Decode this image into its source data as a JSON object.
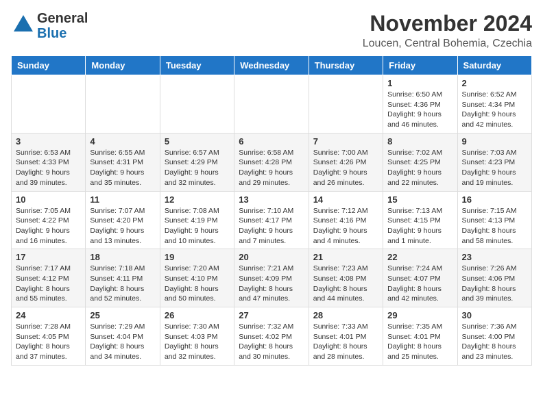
{
  "header": {
    "logo_general": "General",
    "logo_blue": "Blue",
    "month": "November 2024",
    "location": "Loucen, Central Bohemia, Czechia"
  },
  "weekdays": [
    "Sunday",
    "Monday",
    "Tuesday",
    "Wednesday",
    "Thursday",
    "Friday",
    "Saturday"
  ],
  "weeks": [
    [
      {
        "day": "",
        "info": ""
      },
      {
        "day": "",
        "info": ""
      },
      {
        "day": "",
        "info": ""
      },
      {
        "day": "",
        "info": ""
      },
      {
        "day": "",
        "info": ""
      },
      {
        "day": "1",
        "info": "Sunrise: 6:50 AM\nSunset: 4:36 PM\nDaylight: 9 hours and 46 minutes."
      },
      {
        "day": "2",
        "info": "Sunrise: 6:52 AM\nSunset: 4:34 PM\nDaylight: 9 hours and 42 minutes."
      }
    ],
    [
      {
        "day": "3",
        "info": "Sunrise: 6:53 AM\nSunset: 4:33 PM\nDaylight: 9 hours and 39 minutes."
      },
      {
        "day": "4",
        "info": "Sunrise: 6:55 AM\nSunset: 4:31 PM\nDaylight: 9 hours and 35 minutes."
      },
      {
        "day": "5",
        "info": "Sunrise: 6:57 AM\nSunset: 4:29 PM\nDaylight: 9 hours and 32 minutes."
      },
      {
        "day": "6",
        "info": "Sunrise: 6:58 AM\nSunset: 4:28 PM\nDaylight: 9 hours and 29 minutes."
      },
      {
        "day": "7",
        "info": "Sunrise: 7:00 AM\nSunset: 4:26 PM\nDaylight: 9 hours and 26 minutes."
      },
      {
        "day": "8",
        "info": "Sunrise: 7:02 AM\nSunset: 4:25 PM\nDaylight: 9 hours and 22 minutes."
      },
      {
        "day": "9",
        "info": "Sunrise: 7:03 AM\nSunset: 4:23 PM\nDaylight: 9 hours and 19 minutes."
      }
    ],
    [
      {
        "day": "10",
        "info": "Sunrise: 7:05 AM\nSunset: 4:22 PM\nDaylight: 9 hours and 16 minutes."
      },
      {
        "day": "11",
        "info": "Sunrise: 7:07 AM\nSunset: 4:20 PM\nDaylight: 9 hours and 13 minutes."
      },
      {
        "day": "12",
        "info": "Sunrise: 7:08 AM\nSunset: 4:19 PM\nDaylight: 9 hours and 10 minutes."
      },
      {
        "day": "13",
        "info": "Sunrise: 7:10 AM\nSunset: 4:17 PM\nDaylight: 9 hours and 7 minutes."
      },
      {
        "day": "14",
        "info": "Sunrise: 7:12 AM\nSunset: 4:16 PM\nDaylight: 9 hours and 4 minutes."
      },
      {
        "day": "15",
        "info": "Sunrise: 7:13 AM\nSunset: 4:15 PM\nDaylight: 9 hours and 1 minute."
      },
      {
        "day": "16",
        "info": "Sunrise: 7:15 AM\nSunset: 4:13 PM\nDaylight: 8 hours and 58 minutes."
      }
    ],
    [
      {
        "day": "17",
        "info": "Sunrise: 7:17 AM\nSunset: 4:12 PM\nDaylight: 8 hours and 55 minutes."
      },
      {
        "day": "18",
        "info": "Sunrise: 7:18 AM\nSunset: 4:11 PM\nDaylight: 8 hours and 52 minutes."
      },
      {
        "day": "19",
        "info": "Sunrise: 7:20 AM\nSunset: 4:10 PM\nDaylight: 8 hours and 50 minutes."
      },
      {
        "day": "20",
        "info": "Sunrise: 7:21 AM\nSunset: 4:09 PM\nDaylight: 8 hours and 47 minutes."
      },
      {
        "day": "21",
        "info": "Sunrise: 7:23 AM\nSunset: 4:08 PM\nDaylight: 8 hours and 44 minutes."
      },
      {
        "day": "22",
        "info": "Sunrise: 7:24 AM\nSunset: 4:07 PM\nDaylight: 8 hours and 42 minutes."
      },
      {
        "day": "23",
        "info": "Sunrise: 7:26 AM\nSunset: 4:06 PM\nDaylight: 8 hours and 39 minutes."
      }
    ],
    [
      {
        "day": "24",
        "info": "Sunrise: 7:28 AM\nSunset: 4:05 PM\nDaylight: 8 hours and 37 minutes."
      },
      {
        "day": "25",
        "info": "Sunrise: 7:29 AM\nSunset: 4:04 PM\nDaylight: 8 hours and 34 minutes."
      },
      {
        "day": "26",
        "info": "Sunrise: 7:30 AM\nSunset: 4:03 PM\nDaylight: 8 hours and 32 minutes."
      },
      {
        "day": "27",
        "info": "Sunrise: 7:32 AM\nSunset: 4:02 PM\nDaylight: 8 hours and 30 minutes."
      },
      {
        "day": "28",
        "info": "Sunrise: 7:33 AM\nSunset: 4:01 PM\nDaylight: 8 hours and 28 minutes."
      },
      {
        "day": "29",
        "info": "Sunrise: 7:35 AM\nSunset: 4:01 PM\nDaylight: 8 hours and 25 minutes."
      },
      {
        "day": "30",
        "info": "Sunrise: 7:36 AM\nSunset: 4:00 PM\nDaylight: 8 hours and 23 minutes."
      }
    ]
  ]
}
